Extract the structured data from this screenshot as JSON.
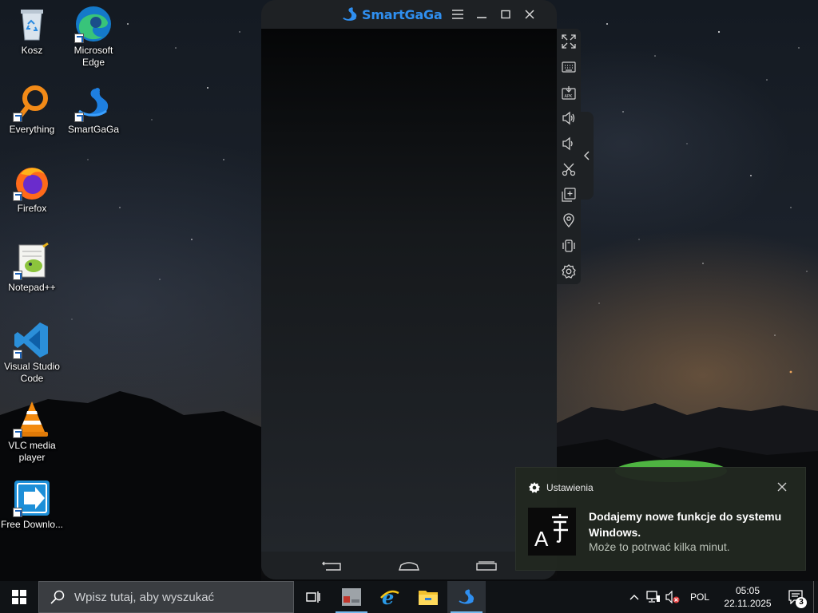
{
  "desktop": {
    "icons": [
      {
        "label": "Kosz",
        "icon": "recycle-bin-icon"
      },
      {
        "label": "Microsoft Edge",
        "icon": "edge-icon"
      },
      {
        "label": "Everything",
        "icon": "everything-search-icon"
      },
      {
        "label": "SmartGaGa",
        "icon": "smartgaga-icon"
      },
      {
        "label": "Firefox",
        "icon": "firefox-icon"
      },
      {
        "label": "Notepad++",
        "icon": "notepad-plus-plus-icon"
      },
      {
        "label": "Visual Studio Code",
        "icon": "vscode-icon"
      },
      {
        "label": "VLC media player",
        "icon": "vlc-icon"
      },
      {
        "label": "Free Downlo...",
        "icon": "free-download-manager-icon"
      }
    ]
  },
  "emulator": {
    "title": "SmartGaGa",
    "controls": [
      "menu-icon",
      "minimize-icon",
      "maximize-icon",
      "close-icon"
    ],
    "side_tools": [
      "fullscreen-icon",
      "keyboard-icon",
      "install-apk-icon",
      "volume-up-icon",
      "volume-down-icon",
      "screenshot-scissors-icon",
      "multi-instance-icon",
      "location-icon",
      "shake-icon",
      "settings-icon"
    ],
    "nav_buttons": [
      "back-icon",
      "home-icon",
      "recents-icon"
    ],
    "accent": "#2f8ff0"
  },
  "toast": {
    "app": "Ustawienia",
    "title": "Dodajemy nowe funkcje do systemu Windows.",
    "body": "Może to potrwać kilka minut."
  },
  "taskbar": {
    "search_placeholder": "Wpisz tutaj, aby wyszukać",
    "apps": [
      "task-view-icon",
      "app-window-icon",
      "internet-explorer-icon",
      "file-explorer-icon",
      "smartgaga-icon"
    ],
    "language": "POL",
    "time": "05:05",
    "date": "22.11.2025",
    "notification_count": "3"
  }
}
